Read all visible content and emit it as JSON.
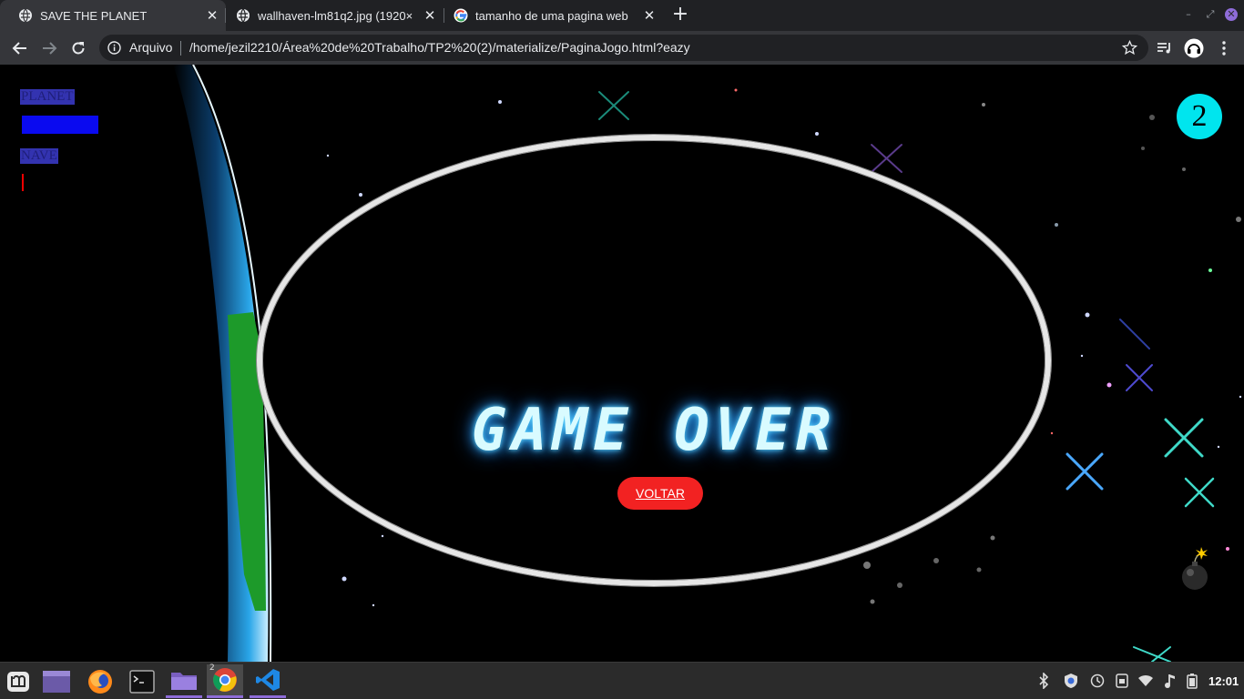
{
  "browser": {
    "tabs": [
      {
        "title": "SAVE THE PLANET",
        "active": true
      },
      {
        "title": "wallhaven-lm81q2.jpg (1920×",
        "active": false
      },
      {
        "title": "tamanho de uma pagina web",
        "active": false
      }
    ],
    "security_label": "Arquivo",
    "url": "/home/jezil2210/Área%20de%20Trabalho/TP2%20(2)/materialize/PaginaJogo.html?eazy"
  },
  "page": {
    "planet_label": "PLANET",
    "nave_label": "NAVE",
    "planet_health": 1.0,
    "nave_health": 0.02,
    "score": "2",
    "game_over_text": "GAME OVER",
    "voltar_label": "VOLTAR",
    "colors": {
      "planet_bar": "#0a0af0",
      "nave_bar": "#ee0000",
      "score_badge": "#00e5ee",
      "voltar_button": "#f22222",
      "game_over_glow": "#5fd6ff"
    }
  },
  "taskbar": {
    "apps": [
      "mint-menu-icon",
      "workspace-switcher-icon",
      "firefox-icon",
      "terminal-icon",
      "files-icon",
      "chrome-icon",
      "vscode-icon"
    ],
    "chrome_window_count": "2",
    "tray": [
      "bluetooth-icon",
      "shield-icon",
      "update-icon",
      "clipboard-icon",
      "wifi-icon",
      "sound-icon",
      "battery-icon"
    ],
    "clock": "12:01"
  }
}
